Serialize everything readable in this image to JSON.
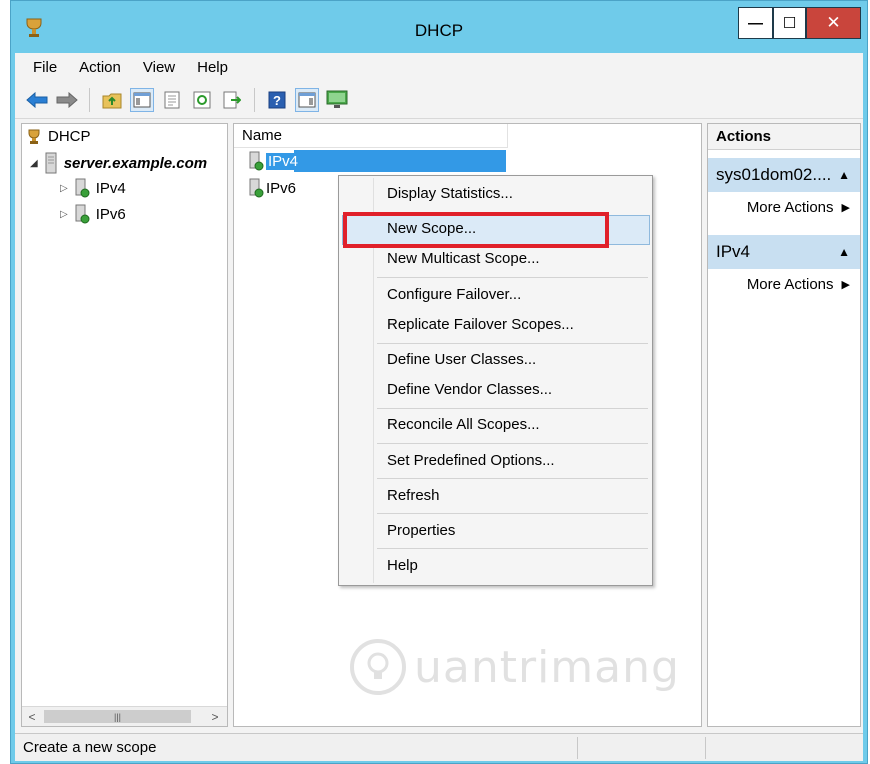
{
  "window": {
    "title": "DHCP",
    "controls": {
      "minimize": "—",
      "maximize": "☐",
      "close": "✕"
    }
  },
  "menu": [
    "File",
    "Action",
    "View",
    "Help"
  ],
  "toolbar": [
    "back-arrow-icon",
    "forward-arrow-icon",
    "folder-up-icon",
    "show-hide-tree-icon",
    "properties-icon",
    "refresh-icon",
    "export-list-icon",
    "help-icon",
    "show-hide-action-pane-icon",
    "monitor-icon"
  ],
  "tree": {
    "root": "DHCP",
    "server": "server.example.com",
    "children": [
      "IPv4",
      "IPv6"
    ]
  },
  "list": {
    "column": "Name",
    "items": [
      "IPv4",
      "IPv6"
    ],
    "selected": "IPv4"
  },
  "context_menu": {
    "items": [
      "Display Statistics...",
      "New Scope...",
      "New Multicast Scope...",
      "Configure Failover...",
      "Replicate Failover Scopes...",
      "Define User Classes...",
      "Define Vendor Classes...",
      "Reconcile All Scopes...",
      "Set Predefined Options...",
      "Refresh",
      "Properties",
      "Help"
    ],
    "highlighted": "New Scope..."
  },
  "actions": {
    "header": "Actions",
    "sections": [
      {
        "title": "sys01dom02....",
        "item": "More Actions"
      },
      {
        "title": "IPv4",
        "item": "More Actions"
      }
    ]
  },
  "statusbar": {
    "text": "Create a new scope"
  },
  "watermark": "uantrimang",
  "colors": {
    "titlebar": "#6fcbea",
    "selection": "#3399e6",
    "action_section": "#c8dff1",
    "highlight_box": "#e0202a",
    "close_button": "#c9453c"
  }
}
